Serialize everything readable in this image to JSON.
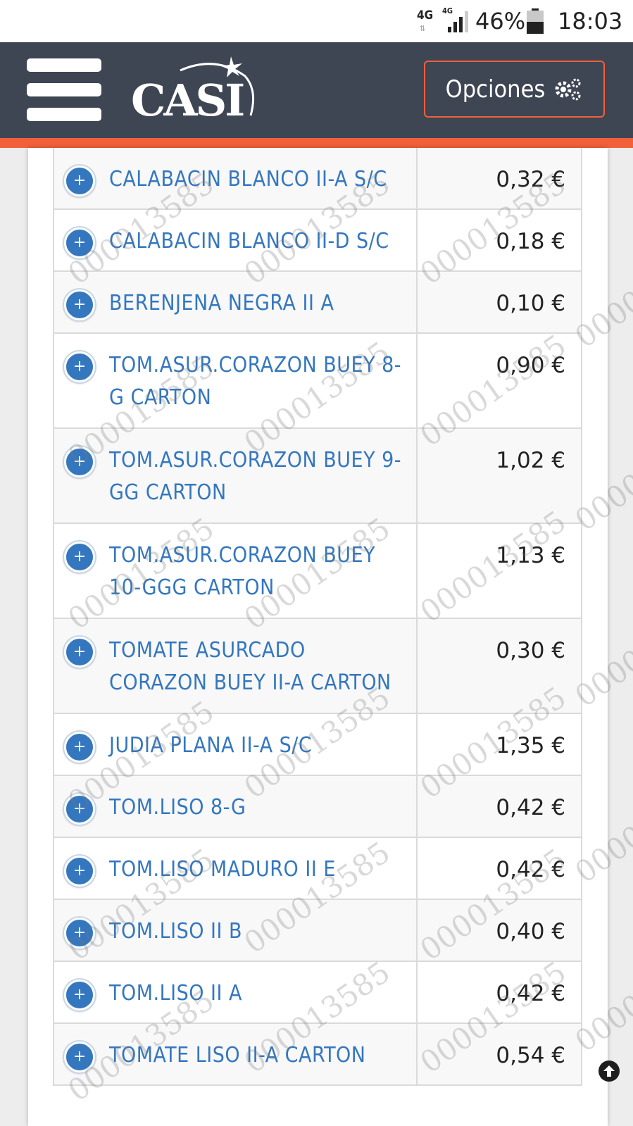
{
  "status_bar": {
    "network": "4G",
    "network_small": "4G",
    "arrows": "⇅",
    "battery": "46%",
    "time": "18:03"
  },
  "header": {
    "logo": "CASI",
    "options_label": "Opciones"
  },
  "watermark_text": "000013585",
  "products": [
    {
      "name": "CALABACIN BLANCO II-A S/C",
      "price": "0,32 €"
    },
    {
      "name": "CALABACIN BLANCO II-D S/C",
      "price": "0,18 €"
    },
    {
      "name": "BERENJENA NEGRA II A",
      "price": "0,10 €"
    },
    {
      "name": "TOM.ASUR.CORAZON BUEY 8-G CARTON",
      "price": "0,90 €"
    },
    {
      "name": "TOM.ASUR.CORAZON BUEY 9-GG CARTON",
      "price": "1,02 €"
    },
    {
      "name": "TOM.ASUR.CORAZON BUEY 10-GGG CARTON",
      "price": "1,13 €"
    },
    {
      "name": "TOMATE ASURCADO CORAZON BUEY II-A CARTON",
      "price": "0,30 €"
    },
    {
      "name": "JUDIA PLANA II-A S/C",
      "price": "1,35 €"
    },
    {
      "name": "TOM.LISO 8-G",
      "price": "0,42 €"
    },
    {
      "name": "TOM.LISO MADURO II E",
      "price": "0,42 €"
    },
    {
      "name": "TOM.LISO II B",
      "price": "0,40 €"
    },
    {
      "name": "TOM.LISO II A",
      "price": "0,42 €"
    },
    {
      "name": "TOMATE LISO II-A CARTON",
      "price": "0,54 €"
    }
  ],
  "colors": {
    "header_bg": "#3e4553",
    "accent": "#f2603a",
    "link": "#3477bf"
  }
}
